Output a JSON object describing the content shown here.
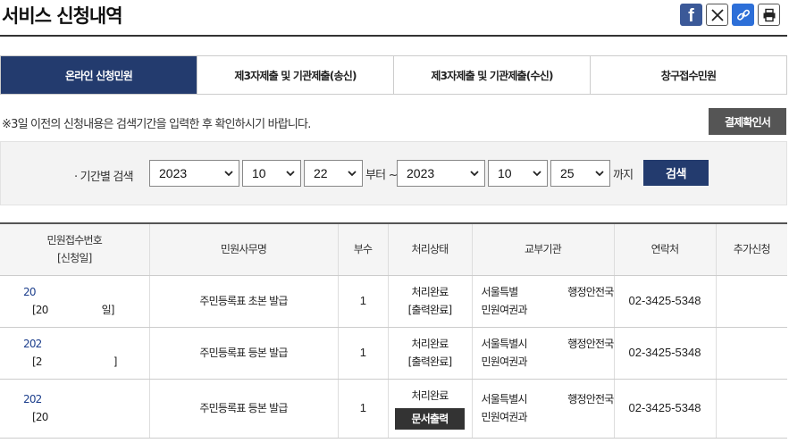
{
  "page": {
    "title": "서비스 신청내역"
  },
  "share": {
    "facebook": "f"
  },
  "tabs": [
    {
      "label": "온라인 신청민원",
      "active": true
    },
    {
      "label": "제3자제출 및 기관제출(송신)",
      "active": false
    },
    {
      "label": "제3자제출 및 기관제출(수신)",
      "active": false
    },
    {
      "label": "창구접수민원",
      "active": false
    }
  ],
  "notice": "※3일 이전의 신청내용은 검색기간을 입력한 후 확인하시기 바랍니다.",
  "confirm_button": "결제확인서",
  "search": {
    "label": "· 기간별 검색",
    "from_year": "2023",
    "from_month": "10",
    "from_day": "22",
    "from_suffix": "부터 ~",
    "to_year": "2023",
    "to_month": "10",
    "to_day": "25",
    "to_suffix": "까지",
    "button": "검색"
  },
  "table": {
    "headers": {
      "id_line1": "민원접수번호",
      "id_line2": "[신청일]",
      "service": "민원사무명",
      "copies": "부수",
      "status": "처리상태",
      "org": "교부기관",
      "contact": "연락처",
      "extra": "추가신청"
    },
    "rows": [
      {
        "id": "20",
        "date": "[20",
        "date_end": "일]",
        "service": "주민등록표 초본 발급",
        "copies": "1",
        "status": "처리완료",
        "substatus": "[출력완료]",
        "org1": "서울특별",
        "org_dept": "행정안전국",
        "org2": "민원여권과",
        "contact": "02-3425-5348"
      },
      {
        "id": "202",
        "date": "[2",
        "date_end": "]",
        "service": "주민등록표 등본 발급",
        "copies": "1",
        "status": "처리완료",
        "substatus": "[출력완료]",
        "org1": "서울특별시",
        "org_dept": "행정안전국",
        "org2": "민원여권과",
        "contact": "02-3425-5348"
      },
      {
        "id": "202",
        "date": "[20",
        "date_end": "]",
        "service": "주민등록표 등본 발급",
        "copies": "1",
        "status": "처리완료",
        "button": "문서출력",
        "org1": "서울특별시",
        "org_dept": "행정안전국",
        "org2": "민원여권과",
        "contact": "02-3425-5348"
      }
    ]
  }
}
